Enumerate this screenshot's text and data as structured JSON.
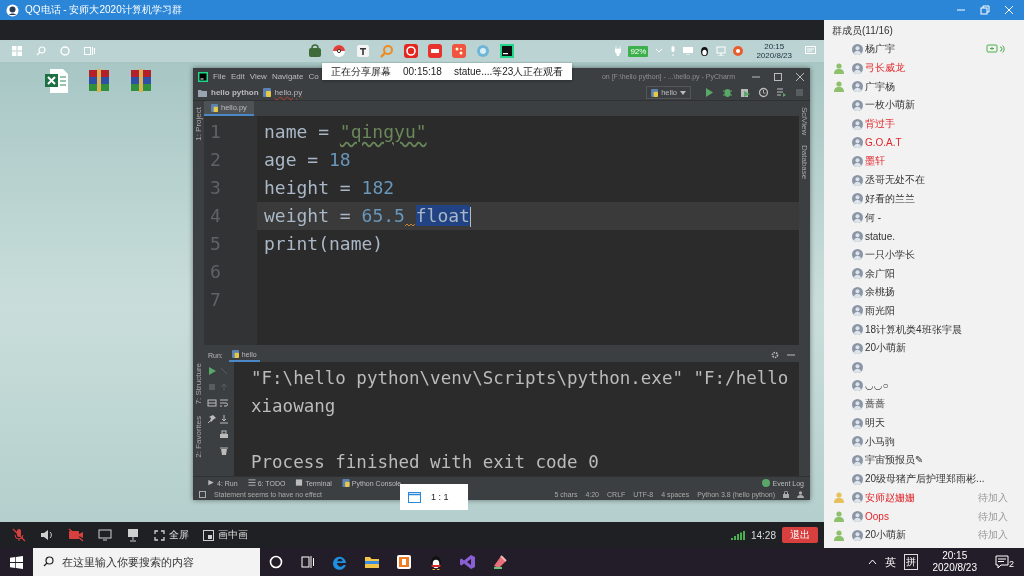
{
  "window": {
    "title": "QQ电话 - 安师大2020计算机学习群"
  },
  "shared_screen": {
    "share_banner": {
      "status": "正在分享屏幕",
      "duration": "00:15:18",
      "viewers": "statue....等23人正在观看"
    },
    "remote_taskbar": {
      "battery": "92%",
      "time": "20:15",
      "date": "2020/8/23"
    },
    "ide": {
      "menu": [
        "File",
        "Edit",
        "View",
        "Navigate",
        "Co"
      ],
      "title": "on [F:\\hello python] - ...\\hello.py - PyCharm",
      "breadcrumbs": [
        {
          "label": "hello python",
          "kind": "folder",
          "error": false
        },
        {
          "label": "hello.py",
          "kind": "file",
          "error": true
        }
      ],
      "run_config": "hello",
      "tabs": [
        {
          "label": "hello.py",
          "selected": true
        }
      ],
      "left_tools": [
        "1: Project",
        "7: Structure",
        "2: Favorites"
      ],
      "right_tools": [
        "SciView",
        "Database"
      ],
      "lines": [
        {
          "number": "1",
          "current": false,
          "tokens": [
            {
              "text": "name = ",
              "kind": "plain",
              "selected": false
            },
            {
              "text": "\"qingyu\"",
              "kind": "string",
              "selected": false,
              "typo": true
            }
          ]
        },
        {
          "number": "2",
          "current": false,
          "tokens": [
            {
              "text": "age = ",
              "kind": "plain",
              "selected": false
            },
            {
              "text": "18",
              "kind": "number",
              "selected": false
            }
          ]
        },
        {
          "number": "3",
          "current": false,
          "tokens": [
            {
              "text": "height = ",
              "kind": "plain",
              "selected": false
            },
            {
              "text": "182",
              "kind": "number",
              "selected": false
            }
          ]
        },
        {
          "number": "4",
          "current": true,
          "tokens": [
            {
              "text": "weight = ",
              "kind": "plain",
              "selected": false
            },
            {
              "text": "65.5",
              "kind": "number",
              "selected": false,
              "warning": true
            },
            {
              "text": "float",
              "kind": "plain",
              "selected": true
            }
          ]
        },
        {
          "number": "5",
          "current": false,
          "tokens": [
            {
              "text": "print(name)",
              "kind": "plain",
              "selected": false
            }
          ]
        },
        {
          "number": "6",
          "current": false
        },
        {
          "number": "7",
          "current": false
        }
      ],
      "run_label": "Run:",
      "run_tab": "hello",
      "output_blocks": [
        [
          "\"F:\\hello python\\venv\\Scripts\\python.exe\" \"F:/hello",
          "xiaowang"
        ],
        [
          "Process finished with exit code 0"
        ]
      ],
      "bottom_tools": [
        "4: Run",
        "6: TODO",
        "Terminal",
        "Python Console"
      ],
      "event_log": "Event Log",
      "status_message": "Statement seems to have no effect",
      "status_items": [
        "5 chars",
        "4:20",
        "CRLF",
        "UTF-8",
        "4 spaces",
        "Python 3.8 (hello python)"
      ]
    },
    "zoom_button": "1 : 1"
  },
  "meeting_controls": [
    {
      "kind": "mic",
      "muted": true
    },
    {
      "kind": "speaker"
    },
    {
      "kind": "camera",
      "muted": true
    },
    {
      "kind": "screen"
    },
    {
      "kind": "whiteboard"
    },
    {
      "kind": "fullscreen",
      "label": "全屏"
    },
    {
      "kind": "pip",
      "label": "画中画"
    }
  ],
  "call_time": "14:28",
  "leave_button": "退出",
  "members_panel": {
    "title": "群成员(11/16)",
    "members": [
      {
        "name": "杨广宇",
        "vip": false,
        "speaking": true
      },
      {
        "name": "弓长威龙",
        "vip": true,
        "speaking": false,
        "role": {
          "color": "#8cc06a"
        }
      },
      {
        "name": "广宇杨",
        "vip": false,
        "speaking": false,
        "role": {
          "color": "#8cc06a"
        }
      },
      {
        "name": "一枚小萌新",
        "vip": false,
        "speaking": false
      },
      {
        "name": "背过手",
        "vip": true,
        "speaking": false
      },
      {
        "name": "G.O.A.T",
        "vip": true,
        "speaking": false
      },
      {
        "name": "墨轩",
        "vip": true,
        "speaking": false
      },
      {
        "name": "丞哥无处不在",
        "vip": false,
        "speaking": false
      },
      {
        "name": "好看的兰兰",
        "vip": false,
        "speaking": false
      },
      {
        "name": "何 -",
        "vip": false,
        "speaking": false
      },
      {
        "name": "statue.",
        "vip": false,
        "speaking": false
      },
      {
        "name": "一只小学长",
        "vip": false,
        "speaking": false
      },
      {
        "name": "余广阳",
        "vip": false,
        "speaking": false
      },
      {
        "name": "余桃扬",
        "vip": false,
        "speaking": false
      },
      {
        "name": "雨光阳",
        "vip": false,
        "speaking": false
      },
      {
        "name": "18计算机类4班张宇晨",
        "vip": false,
        "speaking": false
      },
      {
        "name": "20小萌新",
        "vip": false,
        "speaking": false
      },
      {
        "speaking": false
      },
      {
        "name": "◡◡○",
        "vip": false,
        "speaking": false
      },
      {
        "name": "蔷蔷",
        "vip": false,
        "speaking": false
      },
      {
        "name": "明天",
        "vip": false,
        "speaking": false
      },
      {
        "name": "小马驹",
        "vip": false,
        "speaking": false
      },
      {
        "name": "宇宙预报员✎",
        "vip": false,
        "speaking": false
      },
      {
        "name": "20级母猪产后护理郑雨彬...",
        "vip": false,
        "speaking": false
      },
      {
        "name": "安师赵姗姗",
        "vip": true,
        "speaking": false,
        "role": {
          "color": "#e8c05a"
        },
        "status": "待加入"
      },
      {
        "name": "Oops",
        "vip": true,
        "speaking": false,
        "role": {
          "color": "#8cc06a"
        },
        "status": "待加入"
      },
      {
        "name": "20小萌新",
        "vip": false,
        "speaking": false,
        "role": {
          "color": "#8cc06a"
        },
        "status": "待加入"
      }
    ]
  },
  "taskbar": {
    "search_placeholder": "在这里输入你要搜索的内容",
    "ime_language": "英",
    "ime_mode": "拼",
    "time": "20:15",
    "date": "2020/8/23",
    "notification_count": "2"
  }
}
